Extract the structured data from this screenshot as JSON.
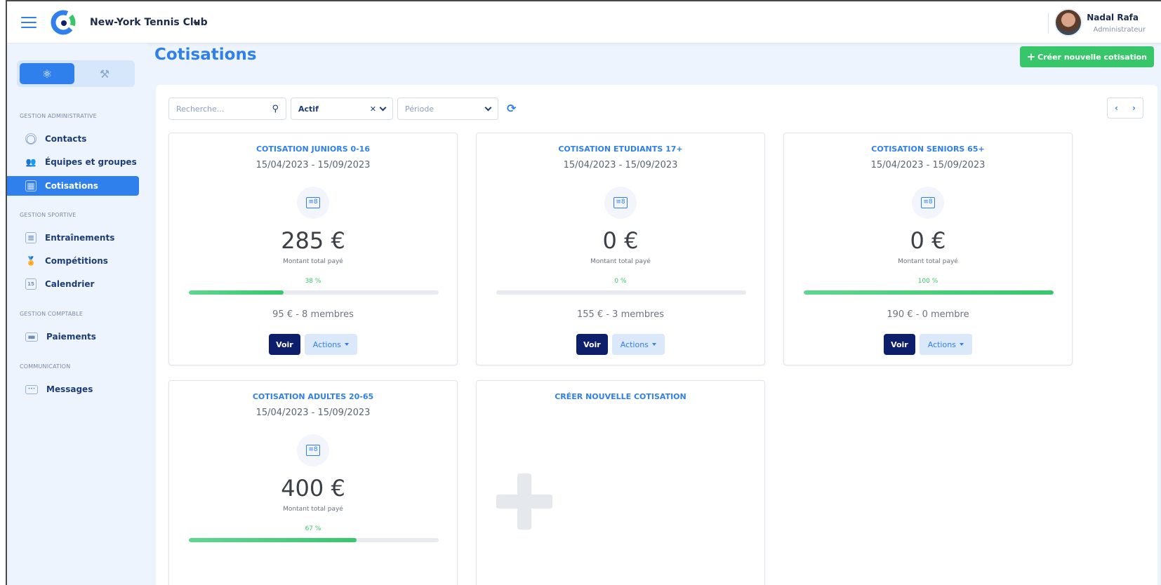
{
  "header": {
    "club_name": "New-York Tennis Club",
    "user_name": "Nadal Rafa",
    "user_role": "Administrateur"
  },
  "sidebar": {
    "sections": [
      {
        "title": "GESTION ADMINISTRATIVE",
        "items": [
          {
            "label": "Contacts",
            "icon": "contact-icon"
          },
          {
            "label": "Équipes et groupes",
            "icon": "groups-icon"
          },
          {
            "label": "Cotisations",
            "icon": "cotisation-icon",
            "active": true
          }
        ]
      },
      {
        "title": "GESTION SPORTIVE",
        "items": [
          {
            "label": "Entraînements",
            "icon": "clipboard-icon"
          },
          {
            "label": "Compétitions",
            "icon": "medal-icon"
          },
          {
            "label": "Calendrier",
            "icon": "calendar-icon"
          }
        ]
      },
      {
        "title": "GESTION COMPTABLE",
        "items": [
          {
            "label": "Paiements",
            "icon": "card-icon"
          }
        ]
      },
      {
        "title": "COMMUNICATION",
        "items": [
          {
            "label": "Messages",
            "icon": "message-icon"
          }
        ]
      }
    ]
  },
  "main": {
    "title": "Cotisations",
    "create_button": "Créer nouvelle cotisation",
    "filters": {
      "search_placeholder": "Recherche...",
      "status_value": "Actif",
      "period_placeholder": "Période"
    },
    "cards": [
      {
        "title": "COTISATION JUNIORS 0-16",
        "dates": "15/04/2023 - 15/09/2023",
        "amount": "285 €",
        "amount_label": "Montant total payé",
        "percent_label": "38 %",
        "percent": 38,
        "members": "95 € -  8 membres"
      },
      {
        "title": "COTISATION ETUDIANTS 17+",
        "dates": "15/04/2023 - 15/09/2023",
        "amount": "0 €",
        "amount_label": "Montant total payé",
        "percent_label": "0 %",
        "percent": 0,
        "members": "155 € -  3 membres"
      },
      {
        "title": "COTISATION SENIORS 65+",
        "dates": "15/04/2023 - 15/09/2023",
        "amount": "0 €",
        "amount_label": "Montant total payé",
        "percent_label": "100 %",
        "percent": 100,
        "members": "190 € -  0 membre"
      },
      {
        "title": "COTISATION ADULTES 20-65",
        "dates": "15/04/2023 - 15/09/2023",
        "amount": "400 €",
        "amount_label": "Montant total payé",
        "percent_label": "67 %",
        "percent": 67,
        "members": ""
      }
    ],
    "create_card_title": "CRÉER NOUVELLE COTISATION",
    "voir_label": "Voir",
    "actions_label": "Actions"
  },
  "colors": {
    "primary": "#2f80ed",
    "success": "#38c66b",
    "dark_button": "#0d1f6b"
  }
}
